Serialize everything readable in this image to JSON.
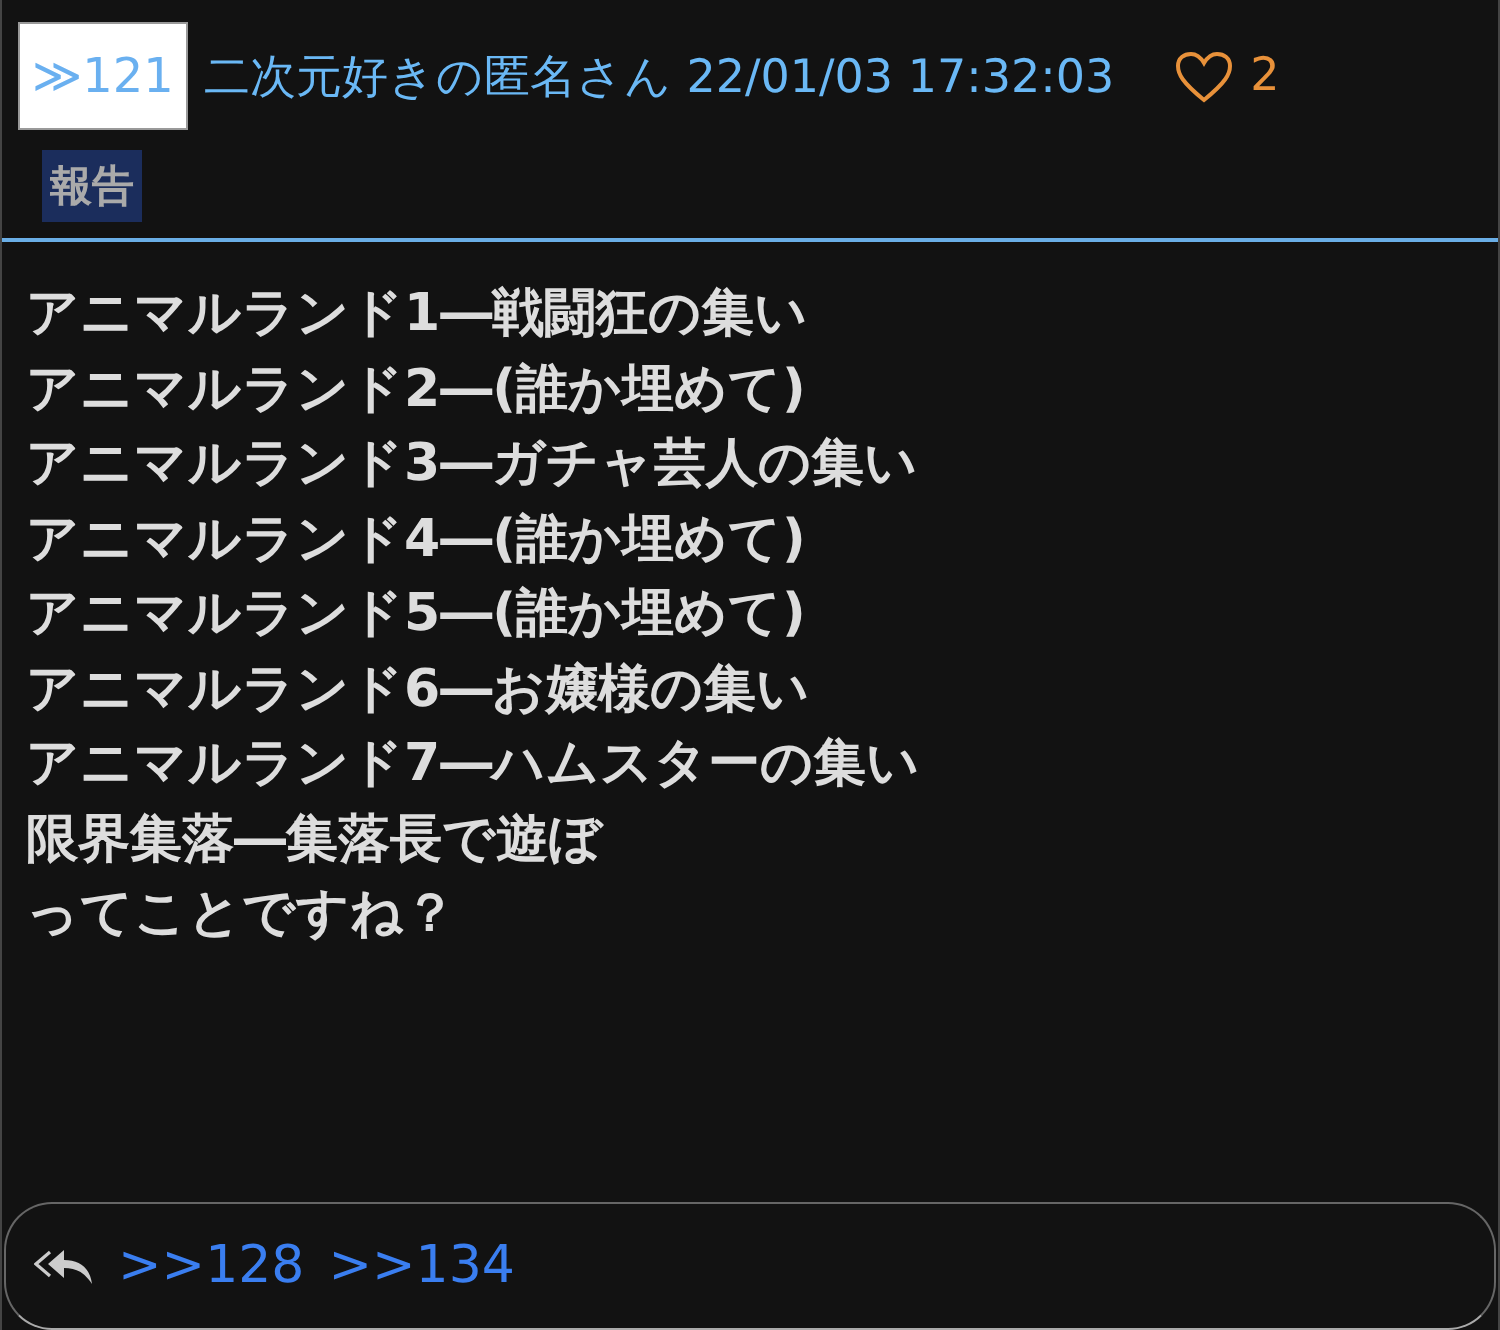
{
  "post": {
    "number": "≫121",
    "name": "二次元好きの匿名さん",
    "date": "22/01/03 17:32:03",
    "likes": "2",
    "report": "報告",
    "lines": [
      "アニマルランド1―戦闘狂の集い",
      "アニマルランド2―(誰か埋めて)",
      "アニマルランド3―ガチャ芸人の集い",
      "アニマルランド4―(誰か埋めて)",
      "アニマルランド5―(誰か埋めて)",
      "アニマルランド6―お嬢様の集い",
      "アニマルランド7―ハムスターの集い",
      "限界集落―集落長で遊ぼ",
      "ってことですね？"
    ],
    "replies": [
      ">>128",
      ">>134"
    ]
  }
}
